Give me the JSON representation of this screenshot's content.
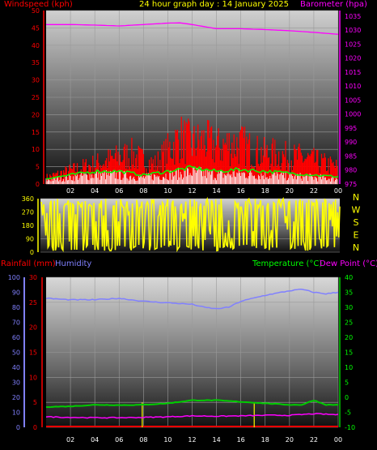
{
  "header": {
    "windspeed_label": "Windspeed (kph)",
    "title": "24 hour graph day : 14 January 2025",
    "barometer_label": "Barometer (hpa)"
  },
  "lower_header": {
    "rainfall_label": "Rainfall (mm)",
    "humidity_label": "Humidity",
    "temperature_label": "Temperature (°C)",
    "dewpoint_label": "Dew Point (°C)"
  },
  "colors": {
    "wind": "#ff0000",
    "gust_band": "#00ff00",
    "wind_direction": "#ffff00",
    "barometer": "#ff00ff",
    "humidity": "#8080ff",
    "temperature": "#00cc00",
    "dewpoint": "#ff00ff",
    "rain": "#ff0000",
    "header_title": "#ffff00",
    "compass_text": "#ffff00"
  },
  "chart_data": [
    {
      "type": "line",
      "name": "wind-barometer",
      "x_ticks": [
        "02",
        "04",
        "06",
        "08",
        "10",
        "12",
        "14",
        "16",
        "18",
        "20",
        "22",
        "00"
      ],
      "y_left": {
        "label": "Windspeed (kph)",
        "ticks": [
          0,
          5,
          10,
          15,
          20,
          25,
          30,
          35,
          40,
          45,
          50
        ],
        "ylim": [
          0,
          50
        ]
      },
      "y_right": {
        "label": "Barometer (hpa)",
        "ticks": [
          975,
          980,
          985,
          990,
          995,
          1000,
          1005,
          1010,
          1015,
          1020,
          1025,
          1030,
          1035
        ],
        "ylim": [
          975,
          1037
        ]
      },
      "barometer": {
        "x": [
          0,
          2,
          4,
          6,
          8,
          10,
          11,
          12,
          14,
          16,
          18,
          20,
          22,
          24
        ],
        "values": [
          1032.0,
          1032.0,
          1031.8,
          1031.5,
          1032.0,
          1032.5,
          1032.6,
          1032.0,
          1030.5,
          1030.5,
          1030.2,
          1029.8,
          1029.2,
          1028.5
        ]
      },
      "wind_avg": {
        "x": [
          0,
          1,
          2,
          3,
          4,
          5,
          6,
          7,
          8,
          9,
          10,
          11,
          12,
          13,
          14,
          15,
          16,
          17,
          18,
          19,
          20,
          21,
          22,
          23,
          24
        ],
        "values": [
          2,
          3,
          4,
          5,
          6,
          7,
          8,
          9,
          7,
          6,
          10,
          14,
          12,
          13,
          11,
          12,
          12,
          10,
          9,
          9,
          8,
          8,
          7,
          6,
          5
        ]
      },
      "wind_gust_band": {
        "x": [
          0,
          2,
          4,
          6,
          8,
          10,
          12,
          14,
          16,
          18,
          20,
          22,
          24
        ],
        "values": [
          1.5,
          2.5,
          3.5,
          3.5,
          2.5,
          3.5,
          4.5,
          3.5,
          4.0,
          3.5,
          3.0,
          2.5,
          2.0
        ]
      },
      "wind_peak_gust": 22
    },
    {
      "type": "line",
      "name": "wind-direction",
      "y_ticks": [
        0,
        90,
        180,
        270,
        360
      ],
      "ylim": [
        0,
        360
      ],
      "compass": [
        "N",
        "W",
        "S",
        "E",
        "N"
      ]
    },
    {
      "type": "line",
      "name": "rain-humidity-temperature",
      "x_ticks": [
        "02",
        "04",
        "06",
        "08",
        "10",
        "12",
        "14",
        "16",
        "18",
        "20",
        "22",
        "00"
      ],
      "y_left_outer": {
        "label": "Humidity",
        "ticks": [
          0,
          10,
          20,
          30,
          40,
          50,
          60,
          70,
          80,
          90,
          100
        ],
        "ylim": [
          0,
          100
        ]
      },
      "y_left_inner": {
        "label": "Rainfall (mm)",
        "ticks": [
          0,
          5,
          10,
          15,
          20,
          25,
          30
        ],
        "ylim": [
          0,
          30
        ]
      },
      "y_right": {
        "label": "Temperature (°C)",
        "ticks": [
          -10,
          -5,
          0,
          5,
          10,
          15,
          20,
          25,
          30,
          35,
          40
        ],
        "ylim": [
          -10,
          40
        ]
      },
      "humidity": {
        "x": [
          0,
          2,
          4,
          6,
          8,
          10,
          12,
          13,
          14,
          15,
          16,
          18,
          20,
          21,
          22,
          23,
          24
        ],
        "values": [
          86,
          85,
          85,
          86,
          84,
          83,
          82,
          80,
          79,
          80,
          84,
          88,
          91,
          92,
          90,
          89,
          90
        ]
      },
      "temperature": {
        "x": [
          0,
          2,
          4,
          6,
          8,
          10,
          11,
          12,
          14,
          16,
          18,
          20,
          21,
          22,
          23,
          24
        ],
        "values": [
          -3.2,
          -3.0,
          -2.5,
          -2.6,
          -2.5,
          -2.0,
          -1.5,
          -1.0,
          -1.0,
          -1.5,
          -2.0,
          -2.5,
          -2.5,
          -1.0,
          -2.5,
          -2.5
        ]
      },
      "dewpoint": {
        "x": [
          0,
          2,
          4,
          6,
          8,
          10,
          12,
          14,
          16,
          18,
          20,
          22,
          24
        ],
        "values": [
          -6.5,
          -6.7,
          -6.8,
          -6.8,
          -6.7,
          -6.5,
          -6.2,
          -6.3,
          -6.2,
          -6.0,
          -6.0,
          -5.5,
          -5.8
        ]
      },
      "rain_markers": {
        "x": [
          7.9,
          17.1
        ],
        "values": [
          1.5,
          1.5
        ]
      }
    }
  ]
}
